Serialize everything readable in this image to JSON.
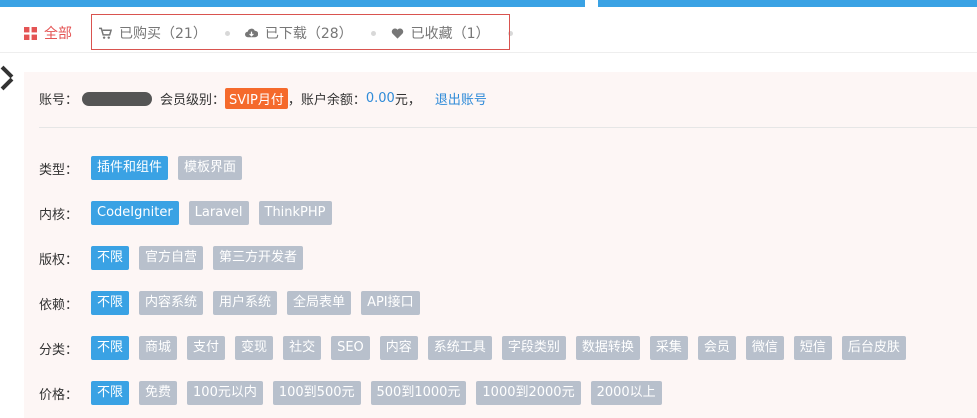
{
  "tabs": [
    {
      "label": "全部",
      "icon": "grid-icon",
      "active": true
    },
    {
      "label": "已购买（21）",
      "icon": "cart-icon"
    },
    {
      "label": "已下载（28）",
      "icon": "cloud-download-icon"
    },
    {
      "label": "已收藏（1）",
      "icon": "heart-icon"
    }
  ],
  "account": {
    "id_label": "账号：",
    "level_label": "会员级别：",
    "level_value": "SVIP月付",
    "balance_label": "，账户余额：",
    "balance_value": "0.00",
    "balance_unit": "元，",
    "logout": "退出账号"
  },
  "filters": [
    {
      "label": "类型：",
      "options": [
        "插件和组件",
        "模板界面"
      ],
      "selected": 0
    },
    {
      "label": "内核：",
      "options": [
        "CodeIgniter",
        "Laravel",
        "ThinkPHP"
      ],
      "selected": 0
    },
    {
      "label": "版权：",
      "options": [
        "不限",
        "官方自营",
        "第三方开发者"
      ],
      "selected": 0
    },
    {
      "label": "依赖：",
      "options": [
        "不限",
        "内容系统",
        "用户系统",
        "全局表单",
        "API接口"
      ],
      "selected": 0
    },
    {
      "label": "分类：",
      "options": [
        "不限",
        "商城",
        "支付",
        "变现",
        "社交",
        "SEO",
        "内容",
        "系统工具",
        "字段类别",
        "数据转换",
        "采集",
        "会员",
        "微信",
        "短信",
        "后台皮肤"
      ],
      "selected": 0
    },
    {
      "label": "价格：",
      "options": [
        "不限",
        "免费",
        "100元以内",
        "100到500元",
        "500到1000元",
        "1000到2000元",
        "2000以上"
      ],
      "selected": 0
    }
  ],
  "colors": {
    "accent": "#3aa2e4",
    "active_tab": "#e45454",
    "svip": "#f56a2c",
    "highlight": "#d9534f"
  }
}
